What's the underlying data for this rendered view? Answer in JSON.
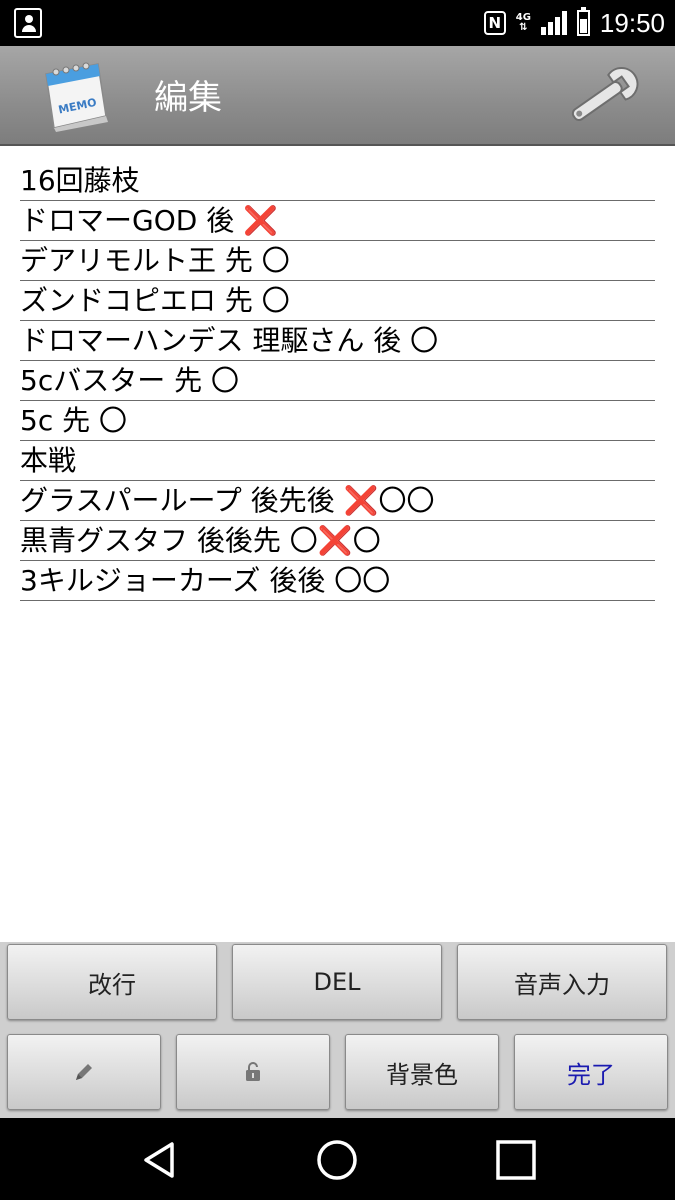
{
  "status_bar": {
    "time": "19:50",
    "network": "4G",
    "icons": [
      "contact-icon",
      "nfc-icon",
      "network-4g-icon",
      "signal-icon",
      "battery-icon"
    ]
  },
  "app_bar": {
    "title": "編集",
    "app_icon": "memo-calendar-icon",
    "logo_text": "MEMO",
    "settings_icon": "wrench-icon"
  },
  "memo": {
    "lines": [
      "16回藤枝",
      "ドロマーGOD 後 ",
      "デアリモルト王 先 〇",
      "ズンドコピエロ 先 〇",
      "ドロマーハンデス 理駆さん 後 〇",
      "5cバスター 先 〇",
      "5c 先 〇",
      "本戦",
      "グラスパーループ 後先後 ",
      "黒青グスタフ 後後先 〇",
      "3キルジョーカーズ 後後 〇〇"
    ],
    "marks": {
      "line2_x": "❌",
      "line9_x": "❌",
      "line9_tail": "〇〇",
      "line10_x": "❌",
      "line10_tail": "〇"
    }
  },
  "buttons": {
    "newline": "改行",
    "del": "DEL",
    "voice": "音声入力",
    "pen_icon": "pencil-icon",
    "lock_icon": "lock-icon",
    "background": "背景色",
    "done": "完了"
  },
  "nav": {
    "icons": [
      "back-icon",
      "home-icon",
      "recents-icon"
    ]
  },
  "colors": {
    "x_mark": "#e01010",
    "done_text": "#1a1ab0",
    "appbar": "#9a9a9a"
  }
}
